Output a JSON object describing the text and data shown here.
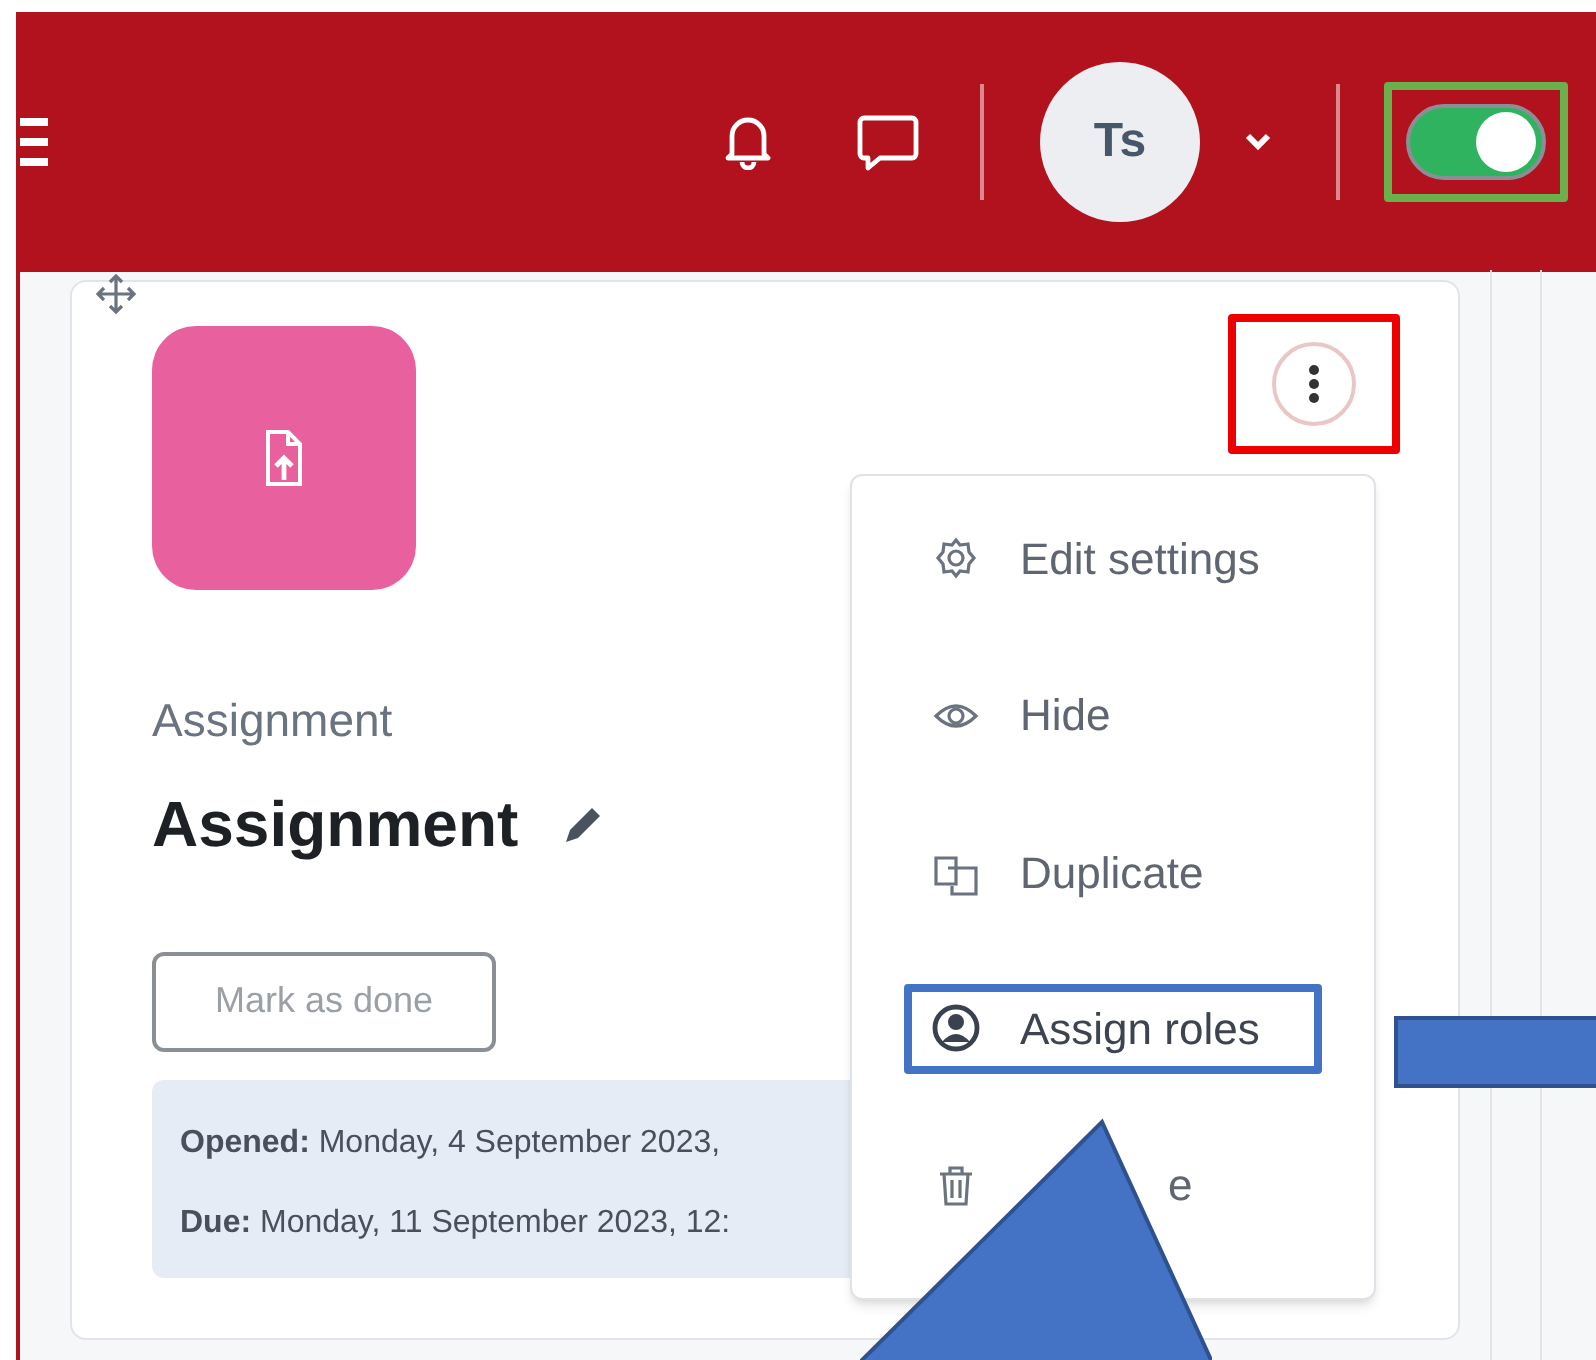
{
  "header": {
    "avatar": {
      "initials": "Ts"
    },
    "edit_mode_toggle": {
      "on": true,
      "highlighted": true
    }
  },
  "activity": {
    "type_label": "Assignment",
    "title": "Assignment",
    "action_menu_button": {
      "highlighted": true
    },
    "completion_button": "Mark as done",
    "dates": [
      "**Opened:** Monday, 4 September 2023,",
      "**Due:** Monday, 11 September 2023, 12:"
    ]
  },
  "menu": {
    "items": [
      {
        "kind": "settings",
        "label": "Edit settings",
        "highlighted": false
      },
      {
        "kind": "hide",
        "label": "Hide",
        "highlighted": false
      },
      {
        "kind": "duplicate",
        "label": "Duplicate",
        "highlighted": false
      },
      {
        "kind": "roles",
        "label": "Assign roles",
        "highlighted": true
      },
      {
        "kind": "delete",
        "label": "e",
        "highlighted": false
      }
    ]
  },
  "annotations": {
    "side_arrow": true,
    "up_arrow": true
  }
}
